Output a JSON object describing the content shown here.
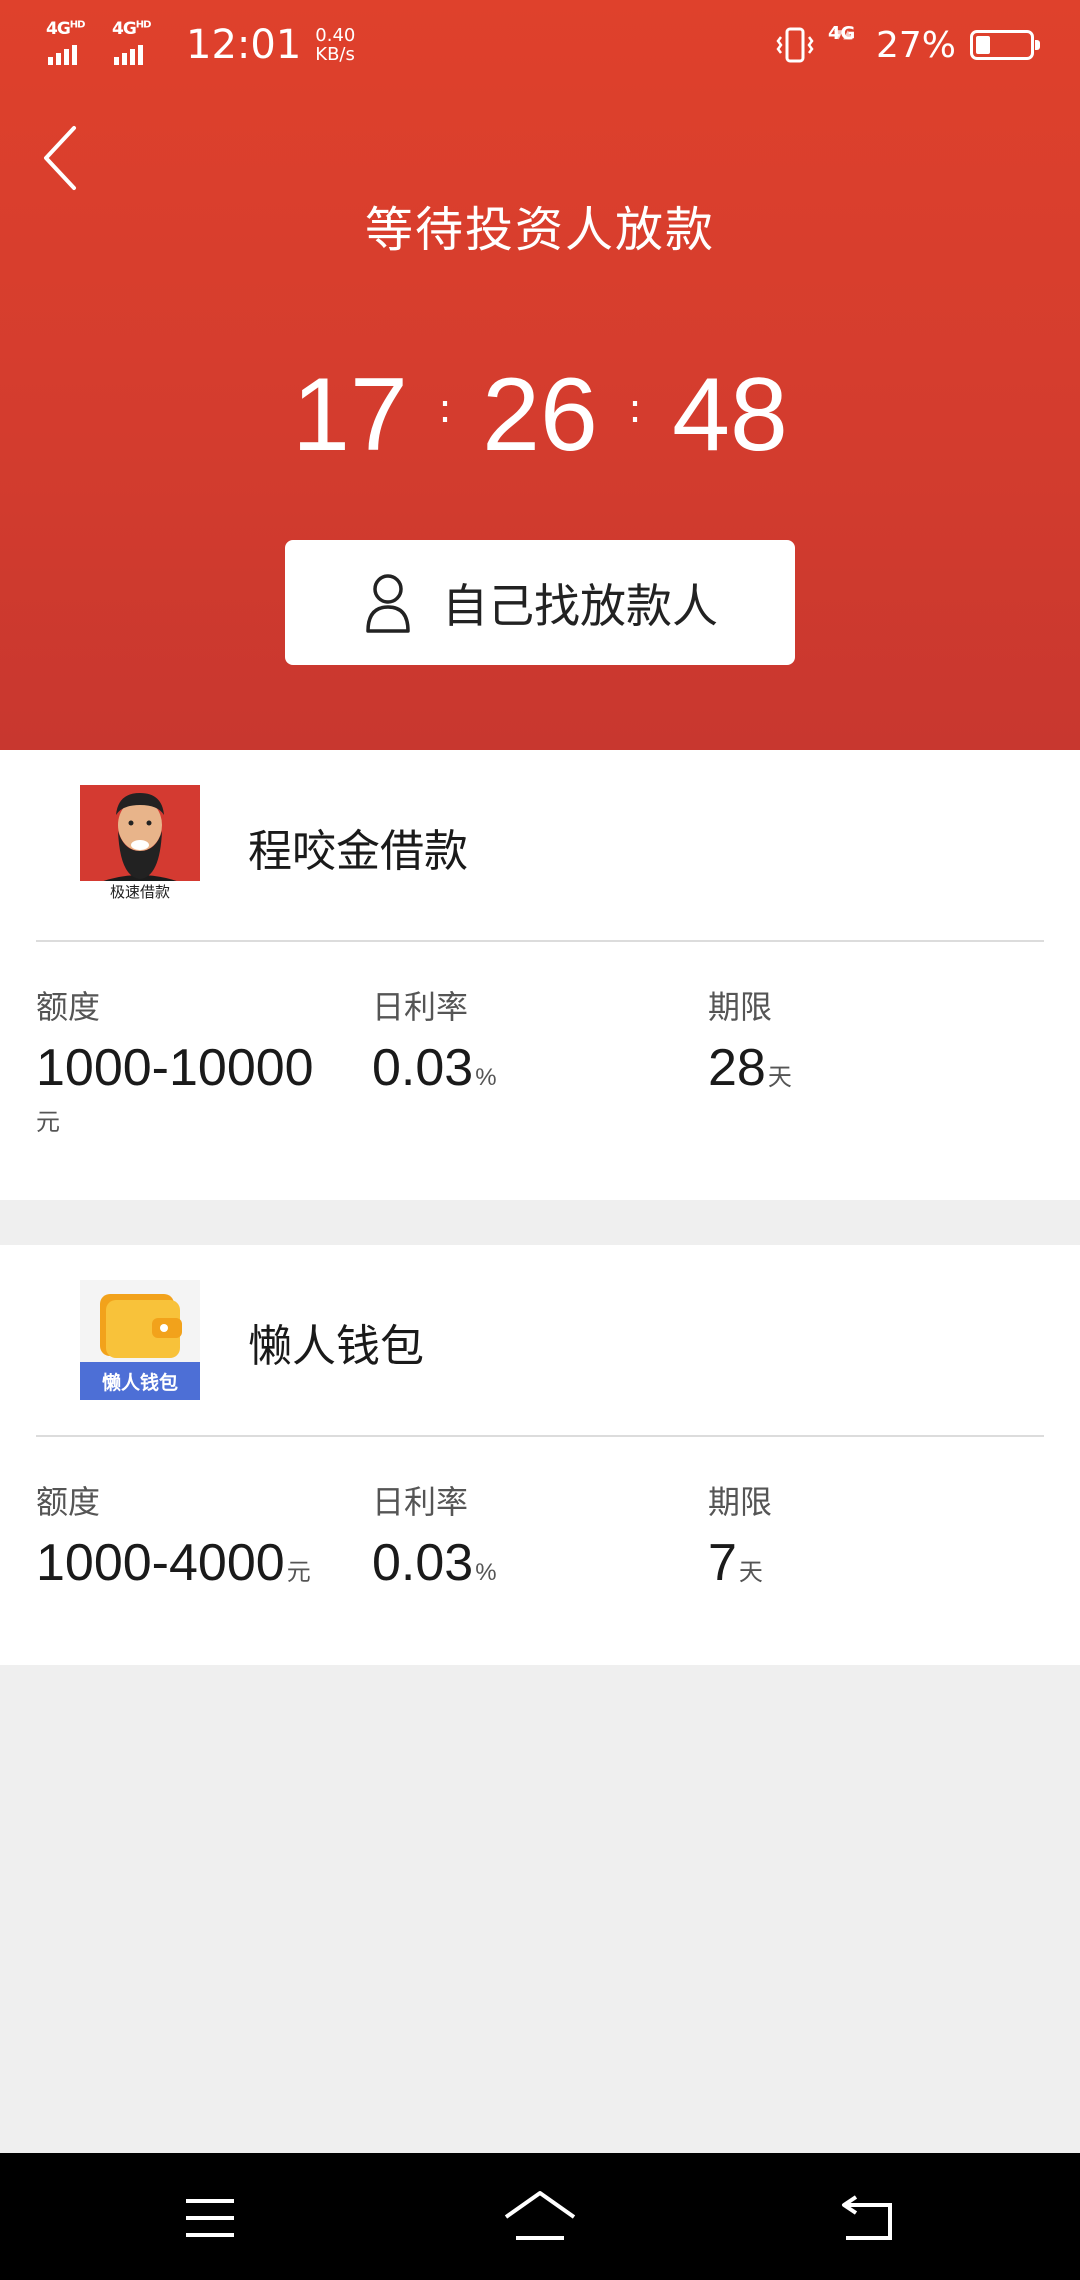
{
  "status_bar": {
    "signal1": "4G",
    "signal2": "4G",
    "hd1": "HD",
    "hd2": "HD",
    "time": "12:01",
    "speed_value": "0.40",
    "speed_unit": "KB/s",
    "net": "4G",
    "battery": "27%"
  },
  "header": {
    "title": "等待投资人放款",
    "countdown": {
      "hours": "17",
      "minutes": "26",
      "seconds": "48",
      "sep": ":"
    },
    "find_lender_label": "自己找放款人"
  },
  "lenders": [
    {
      "name": "程咬金借款",
      "logo_text": "极速借款",
      "amount_label": "额度",
      "amount_value": "1000-10000",
      "amount_unit": "元",
      "rate_label": "日利率",
      "rate_value": "0.03",
      "rate_unit": "%",
      "term_label": "期限",
      "term_value": "28",
      "term_unit": "天"
    },
    {
      "name": "懒人钱包",
      "logo_text": "懒人钱包",
      "amount_label": "额度",
      "amount_value": "1000-4000",
      "amount_unit": "元",
      "rate_label": "日利率",
      "rate_value": "0.03",
      "rate_unit": "%",
      "term_label": "期限",
      "term_value": "7",
      "term_unit": "天"
    }
  ],
  "colors": {
    "header_red": "#df412c",
    "background": "#efefef",
    "navbar": "#000000"
  },
  "icons": {
    "back": "chevron-left-icon",
    "person": "person-icon",
    "menu": "menu-icon",
    "home": "home-icon",
    "return": "back-arrow-icon"
  }
}
